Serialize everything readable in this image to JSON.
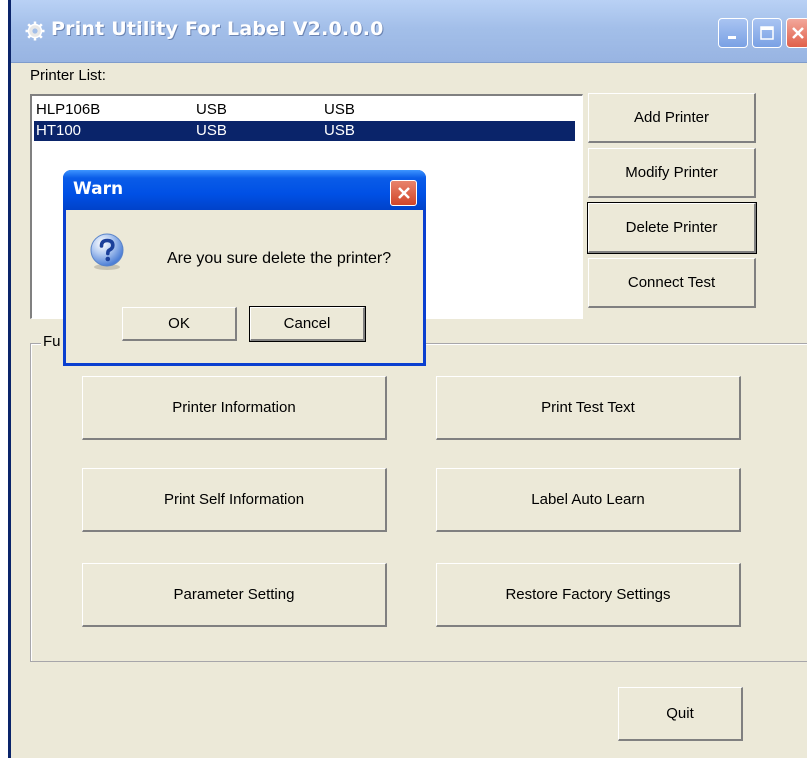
{
  "window": {
    "title": "Print Utility For Label V2.0.0.0"
  },
  "printer_list": {
    "label": "Printer List:",
    "rows": [
      {
        "name": "HLP106B",
        "port": "USB",
        "type": "USB",
        "selected": false
      },
      {
        "name": "HT100",
        "port": "USB",
        "type": "USB",
        "selected": true
      }
    ]
  },
  "side_buttons": {
    "add": "Add Printer",
    "modify": "Modify Printer",
    "delete": "Delete Printer",
    "connect": "Connect Test"
  },
  "function_group": {
    "label": "Fu",
    "buttons": {
      "printer_info": "Printer Information",
      "print_test_text": "Print Test Text",
      "print_self_info": "Print Self Information",
      "label_auto_learn": "Label Auto Learn",
      "parameter_setting": "Parameter Setting",
      "restore_factory": "Restore Factory Settings"
    }
  },
  "quit": "Quit",
  "dialog": {
    "title": "Warn",
    "message": "Are you sure delete the printer?",
    "ok": "OK",
    "cancel": "Cancel",
    "icon": "question-icon"
  },
  "colors": {
    "window_bg": "#ECE9D8",
    "selection": "#0A246A",
    "dialog_titlebar": "#0050E5"
  }
}
